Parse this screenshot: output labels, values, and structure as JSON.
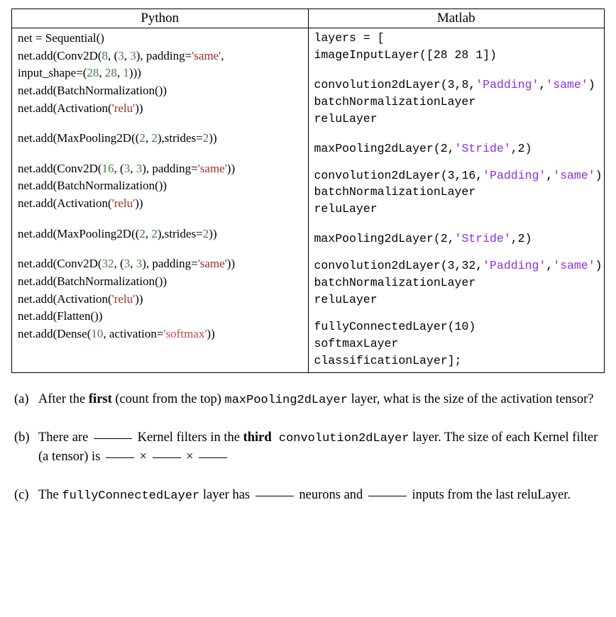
{
  "headers": {
    "left": "Python",
    "right": "Matlab"
  },
  "python": {
    "l1": "net = Sequential()",
    "l2a": "net.add(Conv2D(",
    "l2_num8": "8",
    "l2_dim": "3",
    "l2_dim2": "3",
    "l2_pad": "'same'",
    "l3a": "input_shape=(",
    "l3_nums": [
      "28",
      "28",
      "1"
    ],
    "l4": "net.add(BatchNormalization())",
    "l5a": "net.add(Activation(",
    "l5_str": "'relu'",
    "l6a": "net.add(MaxPooling2D((",
    "l6_nums": [
      "2",
      "2"
    ],
    "l6_stride": "2",
    "l7a": "net.add(Conv2D(",
    "l7_num": "16",
    "l7_dim": "3",
    "l7_dim2": "3",
    "l7_pad": "'same'",
    "l8": "net.add(BatchNormalization())",
    "l9a": "net.add(Activation(",
    "l9_str": "'relu'",
    "l10a": "net.add(MaxPooling2D((",
    "l10_nums": [
      "2",
      "2"
    ],
    "l10_stride": "2",
    "l11a": "net.add(Conv2D(",
    "l11_num": "32",
    "l11_dim": "3",
    "l11_dim2": "3",
    "l11_pad": "'same'",
    "l12": "net.add(BatchNormalization())",
    "l13a": "net.add(Activation(",
    "l13_str": "'relu'",
    "l14": "net.add(Flatten())",
    "l15a": "net.add(Dense(",
    "l15_num": "10",
    "l15_act": "'softmax'"
  },
  "matlab": {
    "m1": "layers = [",
    "m2a": "imageInputLayer([",
    "m2_nums": "28 28 1",
    "m3a": "convolution2dLayer(",
    "m3_nums": "3,8",
    "m3_pad": "'Padding'",
    "m3_same": "'same'",
    "m4": "batchNormalizationLayer",
    "m5": "reluLayer",
    "m6a": "maxPooling2dLayer(",
    "m6_num": "2",
    "m6_stride": "'Stride'",
    "m6_sv": "2",
    "m7a": "convolution2dLayer(",
    "m7_nums": "3,16",
    "m7_pad": "'Padding'",
    "m7_same": "'same'",
    "m8": "batchNormalizationLayer",
    "m9": "reluLayer",
    "m10a": "maxPooling2dLayer(",
    "m10_num": "2",
    "m10_stride": "'Stride'",
    "m10_sv": "2",
    "m11a": "convolution2dLayer(",
    "m11_nums": "3,32",
    "m11_pad": "'Padding'",
    "m11_same": "'same'",
    "m12": "batchNormalizationLayer",
    "m13": "reluLayer",
    "m14a": "fullyConnectedLayer(",
    "m14_num": "10",
    "m15": "softmaxLayer",
    "m16": "classificationLayer];"
  },
  "qa": {
    "a_label": "(a)",
    "a_pre": "After the ",
    "a_bold": "first",
    "a_mid": " (count from the top) ",
    "a_mono": "maxPooling2dLayer",
    "a_tail": " layer, what is the size of the activation tensor?",
    "b_label": "(b)",
    "b_pre": "There are ",
    "b_mid1": " Kernel filters in the ",
    "b_bold": "third",
    "b_mono": " convolution2dLayer",
    "b_mid2": " layer. The size of each Kernel filter (a tensor) is ",
    "b_times": "×",
    "c_label": "(c)",
    "c_pre": "The ",
    "c_mono": "fullyConnectedLayer",
    "c_mid1": " layer has ",
    "c_mid2": " neurons and ",
    "c_tail": " inputs from the last reluLayer."
  }
}
